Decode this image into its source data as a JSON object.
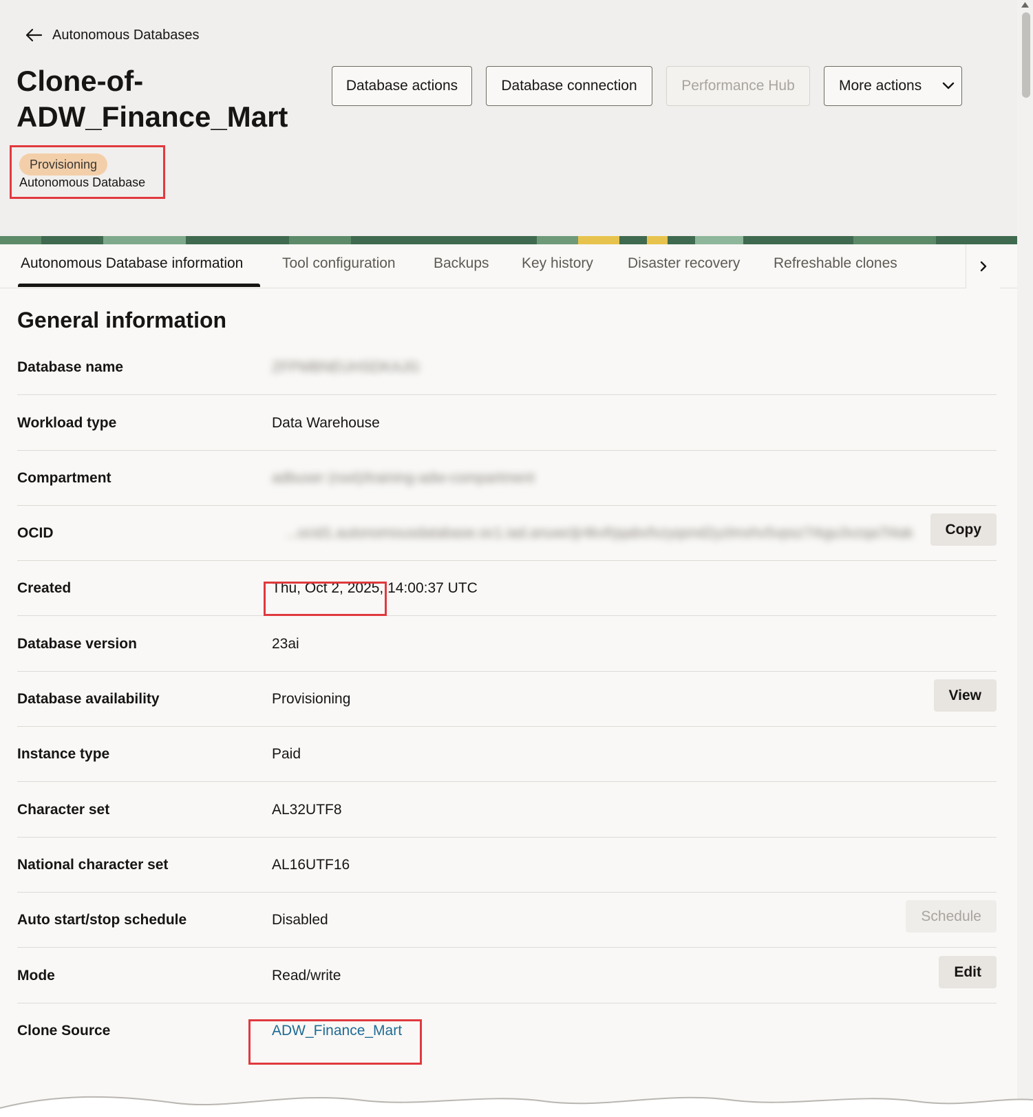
{
  "nav": {
    "back_label": "Autonomous Databases"
  },
  "page": {
    "title_line1": "Clone-of-",
    "title_line2": "ADW_Finance_Mart",
    "status_badge": "Provisioning",
    "resource_type": "Autonomous Database"
  },
  "actions": {
    "database_actions": "Database actions",
    "database_connection": "Database connection",
    "performance_hub": "Performance Hub",
    "more_actions": "More actions"
  },
  "tabs": [
    {
      "label": "Autonomous Database information",
      "active": true
    },
    {
      "label": "Tool configuration"
    },
    {
      "label": "Backups"
    },
    {
      "label": "Key history"
    },
    {
      "label": "Disaster recovery"
    },
    {
      "label": "Refreshable clones"
    }
  ],
  "general": {
    "title": "General information",
    "rows": [
      {
        "label": "Database name",
        "value": "ZFPMBNEUHSDKAJG"
      },
      {
        "label": "Workload type",
        "value": "Data Warehouse"
      },
      {
        "label": "Compartment",
        "value": "adbuser (root)/training-adw-compartment"
      },
      {
        "label": "OCID",
        "value": "...ocid1.autonomousdatabase.oc1.iad.anuwcljr4kvfrjqabvfxzyqsnd2yzlmxhv5vpsz7rkgu3vzqa7l4ak",
        "action": "Copy"
      },
      {
        "label": "Created",
        "value": "Thu, Oct 2, 2025, 14:00:37 UTC"
      },
      {
        "label": "Database version",
        "value": "23ai"
      },
      {
        "label": "Database availability",
        "value": "Provisioning",
        "action": "View"
      },
      {
        "label": "Instance type",
        "value": "Paid"
      },
      {
        "label": "Character set",
        "value": "AL32UTF8"
      },
      {
        "label": "National character set",
        "value": "AL16UTF16"
      },
      {
        "label": "Auto start/stop schedule",
        "value": "Disabled",
        "action": "Schedule"
      },
      {
        "label": "Mode",
        "value": "Read/write",
        "action": "Edit"
      },
      {
        "label": "Clone Source",
        "value": "ADW_Finance_Mart"
      }
    ]
  },
  "colors": {
    "highlight": "#e0393e",
    "badge_bg": "#f3cfa9",
    "link": "#1f6b94",
    "header_bg": "#f1efed"
  }
}
